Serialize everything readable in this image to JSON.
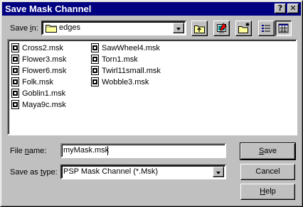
{
  "window": {
    "title": "Save Mask Channel",
    "help_glyph": "?",
    "close_glyph": "✕"
  },
  "save_in": {
    "label_pre": "Save ",
    "label_accel": "i",
    "label_post": "n:",
    "folder": "edges"
  },
  "files": [
    "Cross2.msk",
    "Flower3.msk",
    "Flower6.msk",
    "Folk.msk",
    "Goblin1.msk",
    "Maya9c.msk",
    "SawWheel4.msk",
    "Torn1.msk",
    "Twirl11small.msk",
    "Wobble3.msk"
  ],
  "file_name": {
    "label_pre": "File ",
    "label_accel": "n",
    "label_post": "ame:",
    "value": "myMask.msk"
  },
  "save_as_type": {
    "label_pre": "Save as ",
    "label_accel": "t",
    "label_post": "ype:",
    "value": "PSP Mask Channel (*.Msk)"
  },
  "buttons": {
    "save_accel": "S",
    "save_rest": "ave",
    "cancel": "Cancel",
    "help_accel": "H",
    "help_rest": "elp"
  },
  "colors": {
    "titlebar": "#000080",
    "face": "#c0c0c0",
    "folder_yellow": "#ffff99"
  }
}
